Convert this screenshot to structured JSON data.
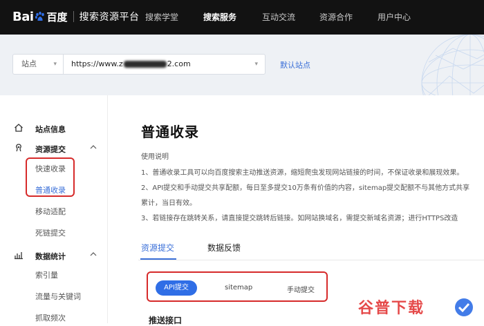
{
  "header": {
    "logo_bai": "Bai",
    "logo_du": "百度",
    "platform": "搜索资源平台",
    "nav": [
      {
        "label": "搜索学堂",
        "active": false
      },
      {
        "label": "搜索服务",
        "active": true
      },
      {
        "label": "互动交流",
        "active": false
      },
      {
        "label": "资源合作",
        "active": false
      },
      {
        "label": "用户中心",
        "active": false
      }
    ]
  },
  "site_bar": {
    "site_label": "站点",
    "url_prefix": "https://www.z",
    "url_suffix": "2.com",
    "default_site_link": "默认站点"
  },
  "sidebar": {
    "site_info": "站点信息",
    "resource_submit": {
      "label": "资源提交",
      "items": [
        "快速收录",
        "普通收录",
        "移动适配",
        "死链提交"
      ]
    },
    "data_stats": {
      "label": "数据统计",
      "items": [
        "索引量",
        "流量与关键词",
        "抓取频次"
      ]
    }
  },
  "main": {
    "title": "普通收录",
    "usage_label": "使用说明",
    "usage_lines": [
      "1、普通收录工具可以向百度搜索主动推送资源，缩短爬虫发现网站链接的时间，不保证收录和展现效果。",
      "2、API提交和手动提交共享配额，每日至多提交10万条有价值的内容，sitemap提交配额不与其他方式共享",
      "累计，当日有效。",
      "3、若链接存在跳转关系，请直接提交跳转后链接。如网站换域名，需提交新域名资源；进行HTTPS改造"
    ],
    "tabs": [
      "资源提交",
      "数据反馈"
    ],
    "methods": [
      "API提交",
      "sitemap",
      "手动提交"
    ],
    "section_heading": "推送接口"
  },
  "watermark": "谷普下载",
  "colors": {
    "accent": "#3a6fd8",
    "highlight": "#d62a2a",
    "topbar": "#121212"
  }
}
